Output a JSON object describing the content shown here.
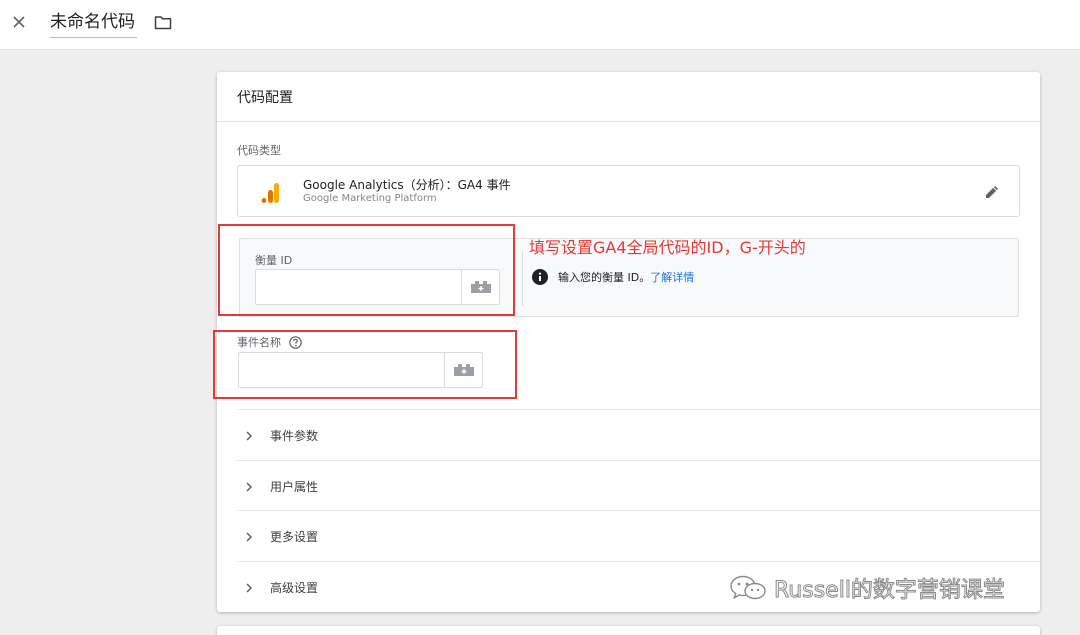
{
  "topbar": {
    "close_icon": "close-icon",
    "tag_name": "未命名代码",
    "folder_icon": "folder-icon"
  },
  "card": {
    "title": "代码配置",
    "tag_type_label": "代码类型",
    "tag_type": {
      "icon": "google-analytics-icon",
      "name": "Google Analytics（分析）：GA4 事件",
      "platform": "Google Marketing Platform",
      "edit_icon": "pencil-icon"
    },
    "measurement_id": {
      "label": "衡量 ID",
      "value": "",
      "variable_icon": "variable-picker-icon"
    },
    "info": {
      "icon": "info-icon",
      "text": "输入您的衡量 ID。",
      "link": "了解详情"
    },
    "event_name": {
      "label": "事件名称",
      "help_icon": "help-circle-icon",
      "value": "",
      "variable_icon": "variable-picker-icon"
    },
    "sections": [
      {
        "label": "事件参数"
      },
      {
        "label": "用户属性"
      },
      {
        "label": "更多设置"
      },
      {
        "label": "高级设置"
      }
    ]
  },
  "annotation": {
    "text": "填写设置GA4全局代码的ID，G-开头的",
    "color": "#e53935"
  },
  "watermark": {
    "text": "Russell的数字营销课堂",
    "icon": "wechat-logo-icon"
  },
  "colors": {
    "link": "#1a73e8",
    "ga_orange": "#f9ab00",
    "ga_dark_orange": "#e37400"
  }
}
